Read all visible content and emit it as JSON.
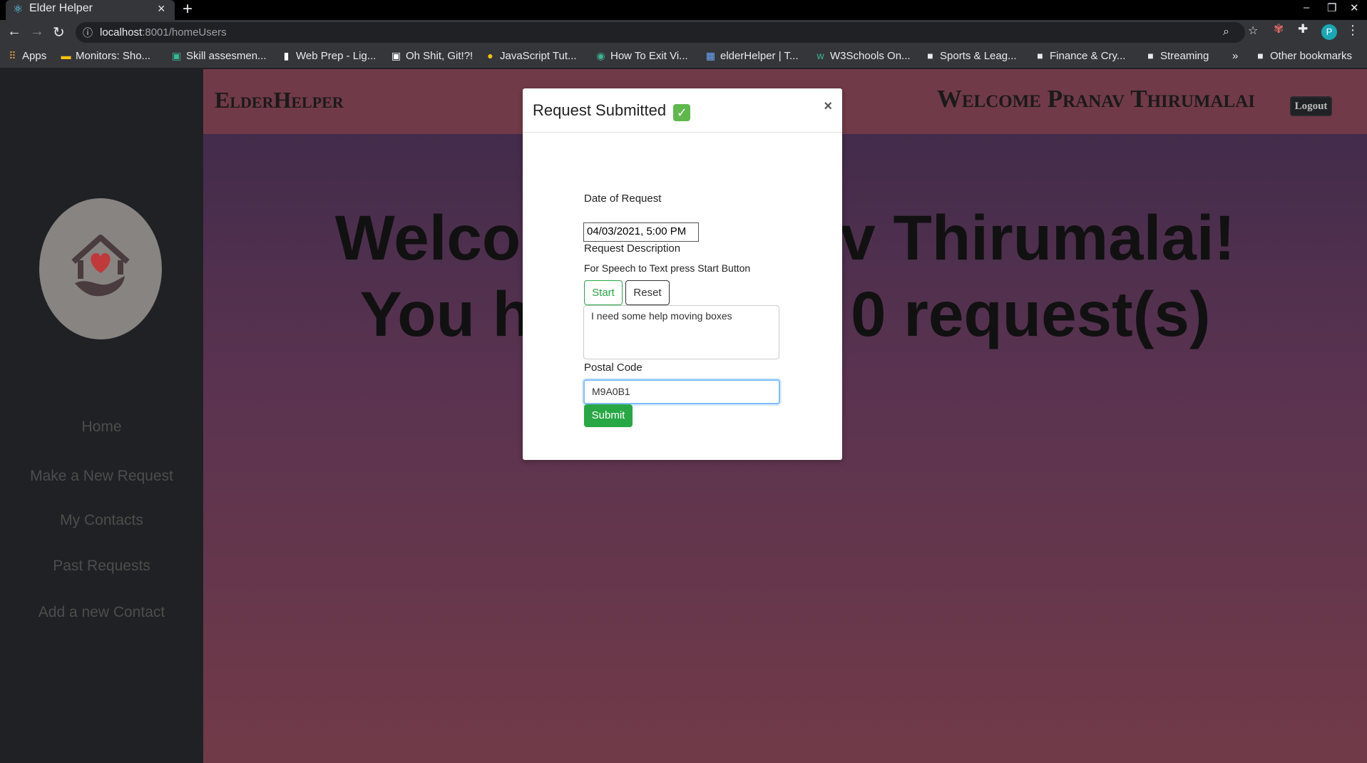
{
  "browser": {
    "tab_title": "Elder Helper",
    "url_host": "localhost",
    "url_rest": ":8001/homeUsers",
    "profile_initial": "P",
    "bookmarks": [
      "Apps",
      "Monitors: Sho...",
      "Skill assesmen...",
      "Web Prep - Lig...",
      "Oh Shit, Git!?!",
      "JavaScript Tut...",
      "How To Exit Vi...",
      "elderHelper | T...",
      "W3Schools On...",
      "Sports & Leag...",
      "Finance & Cry...",
      "Streaming"
    ],
    "bookmarks_overflow": "»",
    "other_bookmarks": "Other bookmarks"
  },
  "sidebar": {
    "nav": [
      "Home",
      "Make a New Request",
      "My Contacts",
      "Past Requests",
      "Add a new Contact"
    ]
  },
  "header": {
    "brand": "ElderHelper",
    "welcome": "Welcome Pranav Thirumalai",
    "logout": "Logout"
  },
  "main": {
    "line1_left": "Welco",
    "line1_right": "v Thirumalai!",
    "line2_left": "You h",
    "line2_right": "0 request(s)"
  },
  "modal": {
    "title": "Request Submitted",
    "title_icon": "check-mark-icon",
    "close": "×",
    "date_label": "Date of Request",
    "date_value": "04/03/2021, 5:00 PM",
    "desc_label": "Request Description",
    "speech_hint": "For Speech to Text press Start Button",
    "start": "Start",
    "reset": "Reset",
    "desc_value": "I need some help moving boxes",
    "postal_label": "Postal Code",
    "postal_value": "M9A0B1",
    "submit": "Submit"
  },
  "colors": {
    "header": "#713a48",
    "sidebar": "#202124",
    "submit": "#28a745",
    "start_text": "#28a745"
  }
}
